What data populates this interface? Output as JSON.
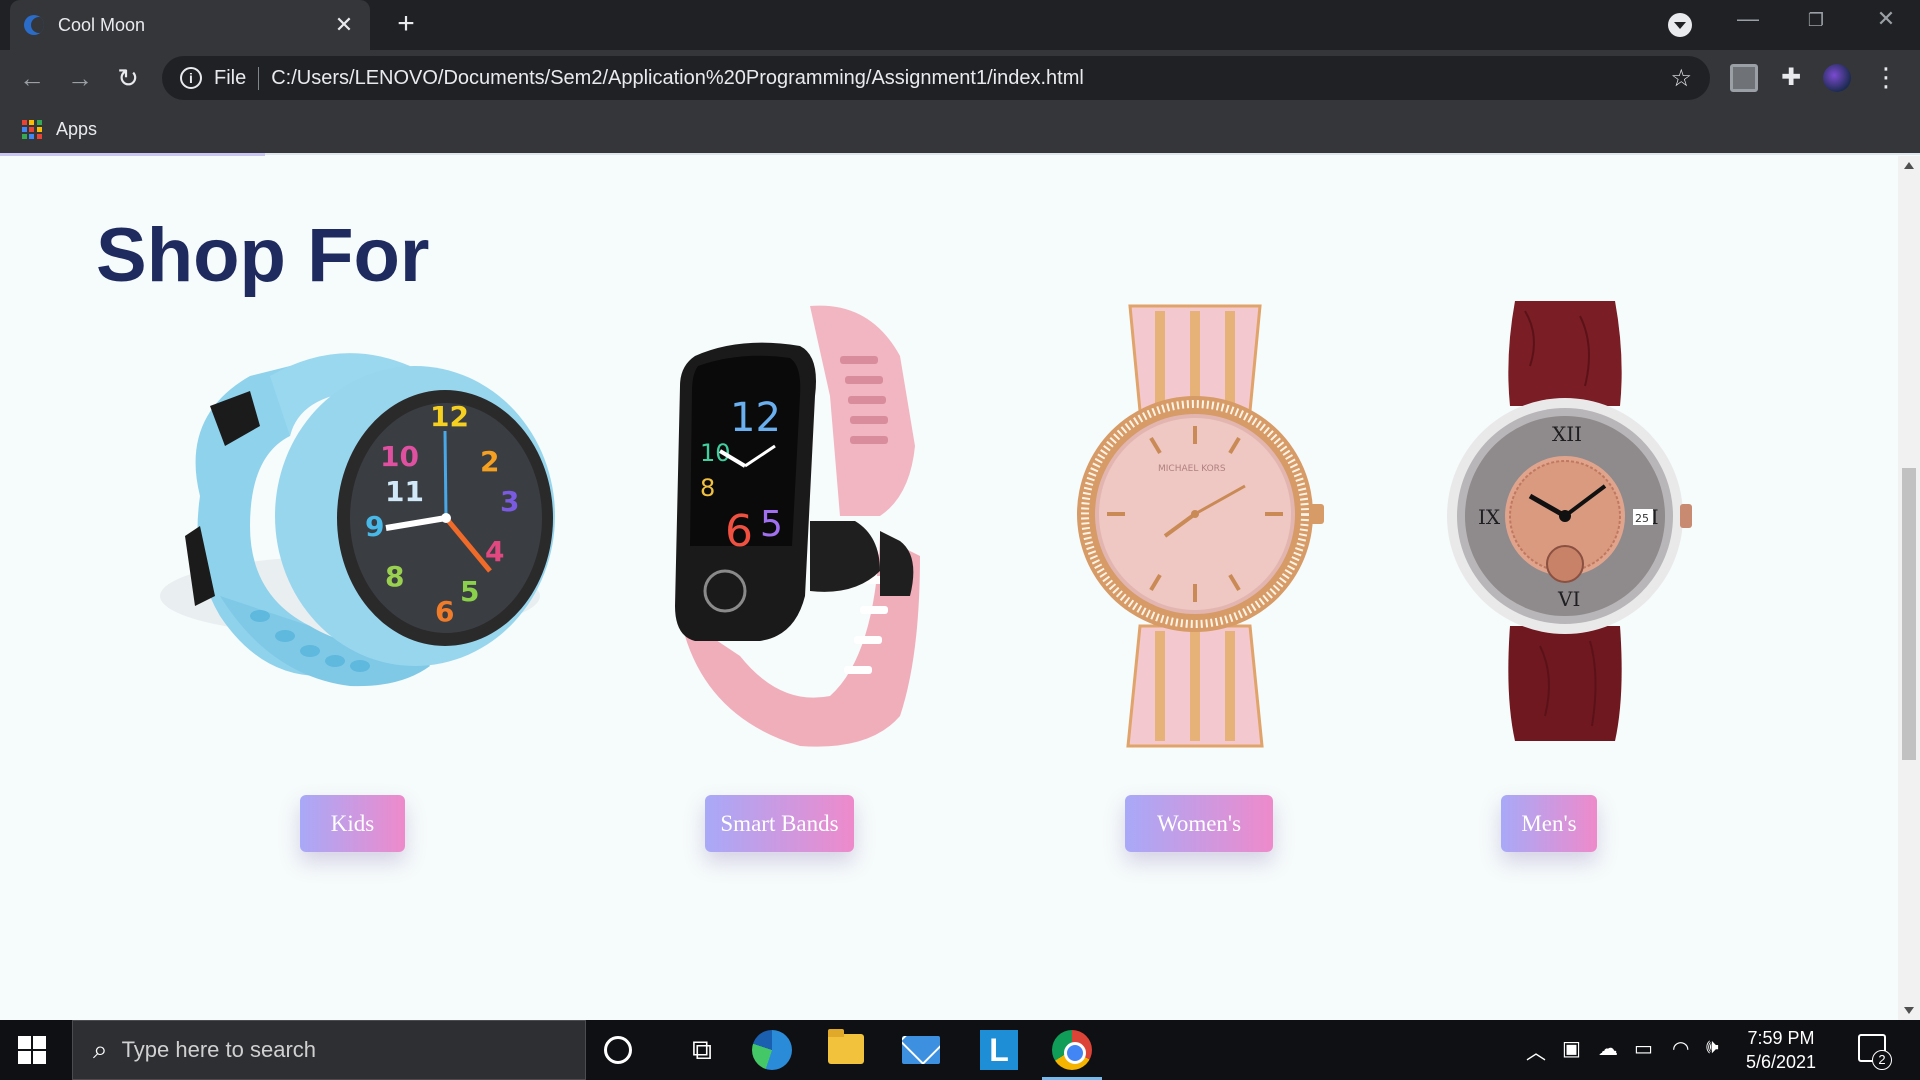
{
  "browser": {
    "tab_title": "Cool Moon",
    "tab_close": "✕",
    "new_tab": "+",
    "url_protocol": "File",
    "url": "C:/Users/LENOVO/Documents/Sem2/Application%20Programming/Assignment1/index.html",
    "bookmarks": {
      "apps_label": "Apps"
    }
  },
  "page": {
    "heading": "Shop For",
    "categories": [
      {
        "label": "Kids",
        "image": "kids-smartwatch"
      },
      {
        "label": "Smart Bands",
        "image": "pink-fitness-band"
      },
      {
        "label": "Women's",
        "image": "rose-gold-womens-watch"
      },
      {
        "label": "Men's",
        "image": "leather-strap-mens-watch"
      }
    ],
    "colors": {
      "heading": "#1f2b5e",
      "button_gradient_start": "#a8a9f8",
      "button_gradient_end": "#ee8acb",
      "background": "#f6fbfb"
    }
  },
  "taskbar": {
    "search_placeholder": "Type here to search",
    "time": "7:59 PM",
    "date": "5/6/2021",
    "notification_count": "2"
  }
}
